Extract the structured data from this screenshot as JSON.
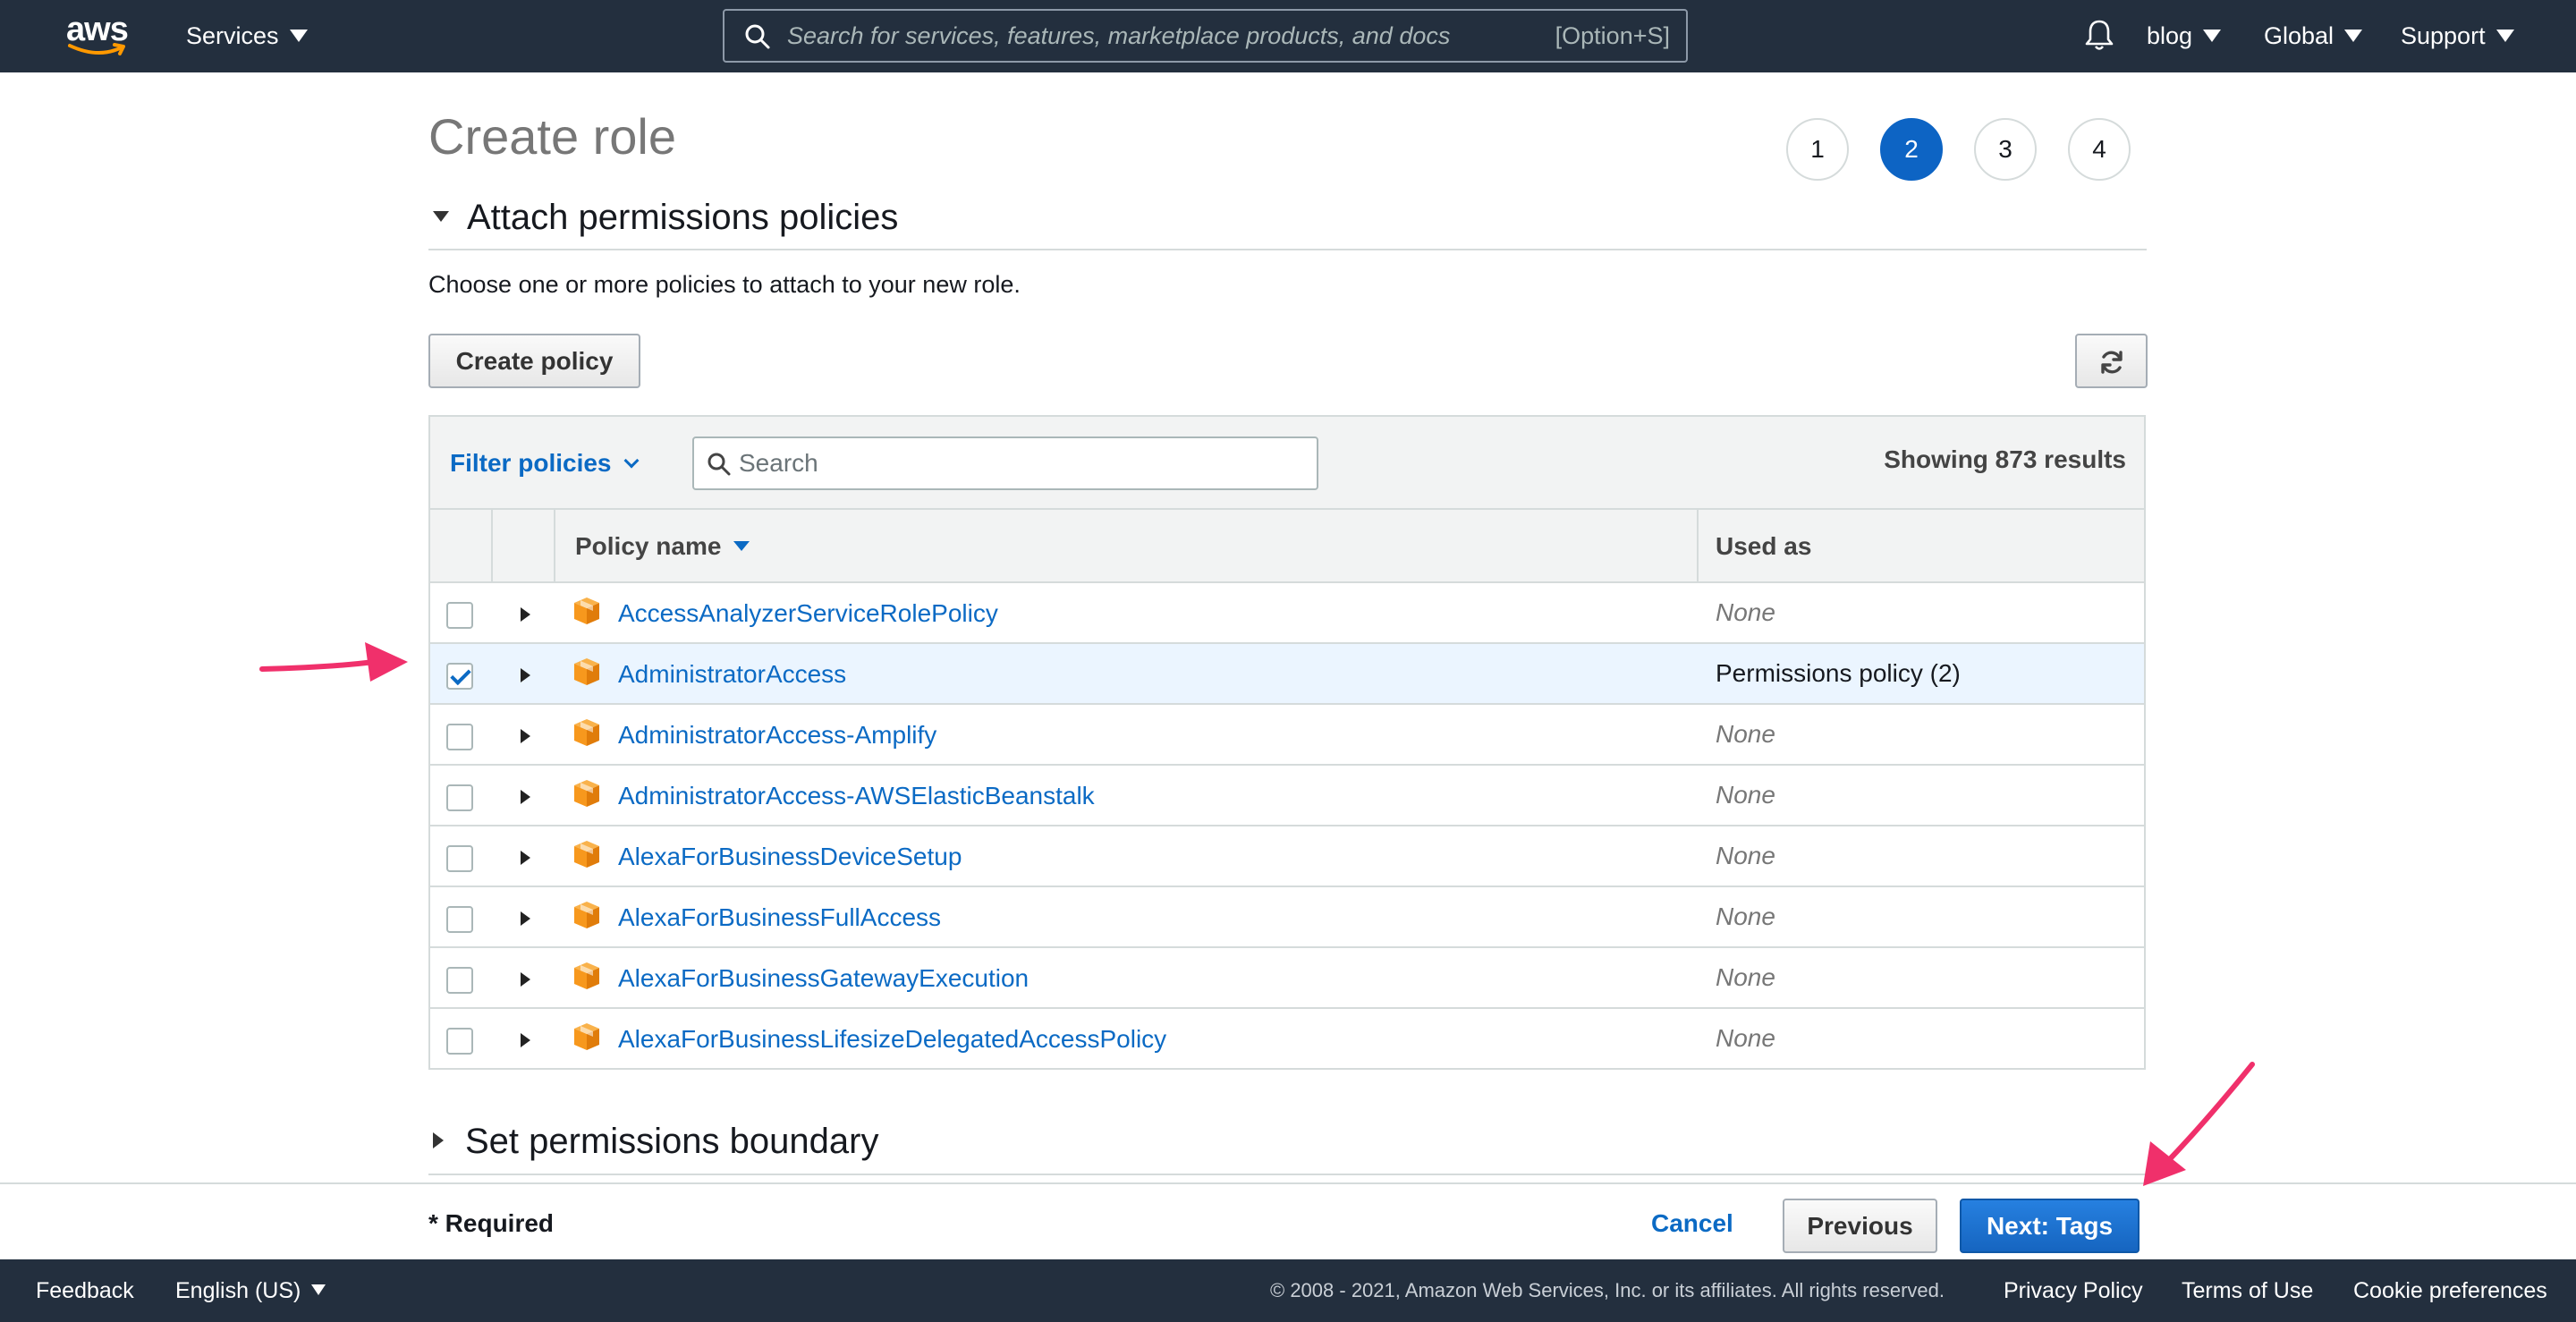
{
  "topnav": {
    "logo_text": "aws",
    "services_label": "Services",
    "search_placeholder": "Search for services, features, marketplace products, and docs",
    "search_shortcut": "[Option+S]",
    "account_label": "blog",
    "region_label": "Global",
    "support_label": "Support"
  },
  "page": {
    "title": "Create role",
    "steps": [
      "1",
      "2",
      "3",
      "4"
    ],
    "active_step": 2
  },
  "attach_section": {
    "heading": "Attach permissions policies",
    "description": "Choose one or more policies to attach to your new role.",
    "create_policy_label": "Create policy",
    "filter_label": "Filter policies",
    "search_placeholder": "Search",
    "showing_text": "Showing 873 results",
    "columns": {
      "policy_name": "Policy name",
      "used_as": "Used as"
    },
    "rows": [
      {
        "name": "AccessAnalyzerServiceRolePolicy",
        "used_as": "None",
        "checked": false
      },
      {
        "name": "AdministratorAccess",
        "used_as": "Permissions policy (2)",
        "checked": true
      },
      {
        "name": "AdministratorAccess-Amplify",
        "used_as": "None",
        "checked": false
      },
      {
        "name": "AdministratorAccess-AWSElasticBeanstalk",
        "used_as": "None",
        "checked": false
      },
      {
        "name": "AlexaForBusinessDeviceSetup",
        "used_as": "None",
        "checked": false
      },
      {
        "name": "AlexaForBusinessFullAccess",
        "used_as": "None",
        "checked": false
      },
      {
        "name": "AlexaForBusinessGatewayExecution",
        "used_as": "None",
        "checked": false
      },
      {
        "name": "AlexaForBusinessLifesizeDelegatedAccessPolicy",
        "used_as": "None",
        "checked": false
      }
    ]
  },
  "boundary_section": {
    "heading": "Set permissions boundary"
  },
  "actions": {
    "required_note": "* Required",
    "cancel_label": "Cancel",
    "previous_label": "Previous",
    "next_label": "Next: Tags"
  },
  "footer": {
    "feedback_label": "Feedback",
    "language_label": "English (US)",
    "copyright": "© 2008 - 2021, Amazon Web Services, Inc. or its affiliates. All rights reserved.",
    "privacy_label": "Privacy Policy",
    "terms_label": "Terms of Use",
    "cookie_label": "Cookie preferences"
  },
  "colors": {
    "nav_bg": "#232f3e",
    "link_blue": "#0b6ac4",
    "primary_button": "#1665c0",
    "annotation_arrow": "#f0306b",
    "package_orange": "#f7981d"
  },
  "icons": {
    "bell": "bell-icon",
    "search": "search-icon",
    "refresh": "refresh-icon",
    "package": "package-icon"
  }
}
